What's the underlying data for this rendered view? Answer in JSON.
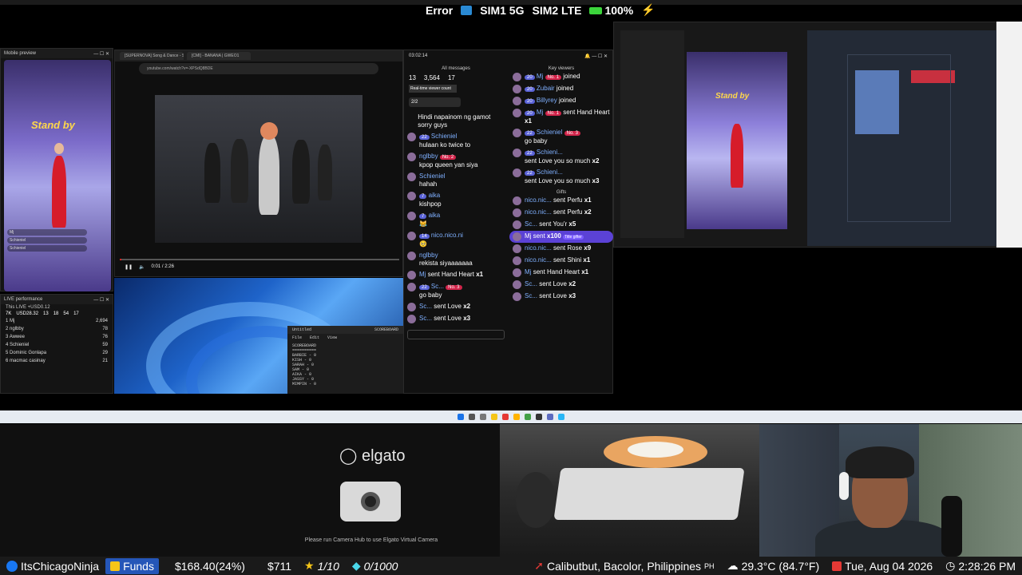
{
  "status_bar": {
    "error": "Error",
    "sim1": "SIM1 5G",
    "sim2": "SIM2 LTE",
    "battery": "100%"
  },
  "mobile_preview": {
    "title": "Mobile preview",
    "standby": "Stand by"
  },
  "live_performance": {
    "title": "LIVE performance",
    "subtitle": "This LIVE +USD0.12",
    "stats": [
      "7K",
      "USD28.32",
      "13",
      "18",
      "54",
      "17"
    ],
    "rows": [
      {
        "rank": "1",
        "name": "Mj",
        "score": "2,694"
      },
      {
        "rank": "2",
        "name": "nglbby",
        "score": "78"
      },
      {
        "rank": "3",
        "name": "Awwee",
        "score": "76"
      },
      {
        "rank": "4",
        "name": "Schieniel",
        "score": "59"
      },
      {
        "rank": "5",
        "name": "Dominic Gonlapa",
        "score": "29"
      },
      {
        "rank": "6",
        "name": "macmac casinay",
        "score": "21"
      }
    ]
  },
  "browser": {
    "tabs": [
      "[SUPERNOVA] Song & Dance - Sou",
      "[CMI] - BANANA | GWEO1"
    ],
    "url": "youtube.com/watch?v=-XPSdQ8BDE",
    "time": "0:01 / 2:26",
    "progress": 0.005
  },
  "notepad": {
    "title": "Untitled",
    "header": "SCOREBOARD",
    "menu": [
      "File",
      "Edit",
      "View"
    ],
    "lines": [
      "SCOREBOARD",
      "==========",
      "BARBIE - 0",
      "KISH - 0",
      "SARAH - 0",
      "SAM - 0",
      "AIKA - 0",
      "JASSY - 0",
      "MIMPIN - 0"
    ]
  },
  "chat": {
    "timer": "03:02:14",
    "all_messages": "All messages",
    "key_viewers": "Key viewers",
    "gifts_label": "Gifts",
    "viewers": "13",
    "views": "3,564",
    "likes": "17",
    "tooltip": "Real-time viewer count",
    "counter": "2/2",
    "messages": [
      {
        "user": "",
        "text": "Hindi napainom ng gamot sorry guys"
      },
      {
        "user": "Schieniel",
        "level": "22",
        "text": "hulaan ko twice to"
      },
      {
        "user": "nglbby",
        "badge": "No. 2",
        "text": "kpop queen yan siya"
      },
      {
        "user": "Schieniel",
        "text": "hahah"
      },
      {
        "user": "aika",
        "level": "7",
        "text": "kishpop"
      },
      {
        "user": "aika",
        "level": "7",
        "text": "😹"
      },
      {
        "user": "nico.nico.ni",
        "level": "14",
        "text": "🥺"
      },
      {
        "user": "nglbby",
        "text": "rekista siyaaaaaaa"
      },
      {
        "user": "Mj",
        "text": "sent Hand Heart",
        "mult": "x1"
      },
      {
        "user": "Sc...",
        "level": "22",
        "badge": "No. 3",
        "text": "go baby"
      },
      {
        "user": "Sc...",
        "text": "sent Love",
        "mult": "x2"
      },
      {
        "user": "Sc...",
        "text": "sent Love",
        "mult": "x3"
      }
    ],
    "key_viewer_events": [
      {
        "level": "20",
        "user": "Mj",
        "badge": "No. 1",
        "text": "joined"
      },
      {
        "level": "20",
        "user": "Zubair",
        "text": "joined"
      },
      {
        "level": "20",
        "user": "Billyrey",
        "text": "joined"
      },
      {
        "level": "20",
        "user": "Mj",
        "badge": "No. 1",
        "text": "sent Hand Heart",
        "mult": "x1"
      },
      {
        "level": "22",
        "user": "Schieniel",
        "badge": "No. 3",
        "text": "go baby"
      },
      {
        "level": "22",
        "user": "Schieni...",
        "text": "sent Love you so much",
        "mult": "x2"
      },
      {
        "level": "22",
        "user": "Schieni...",
        "text": "sent Love you so much",
        "mult": "x3"
      }
    ],
    "gifts": [
      {
        "user": "nico.nic...",
        "text": "sent Perfu",
        "mult": "x1"
      },
      {
        "user": "nico.nic...",
        "text": "sent Perfu",
        "mult": "x2"
      },
      {
        "user": "Sc...",
        "text": "sent You'r",
        "mult": "x5"
      },
      {
        "user": "Mj sent",
        "text": "",
        "mult": "x100",
        "tag": "Title gifter",
        "highlight": true
      },
      {
        "user": "nico.nic...",
        "text": "sent Rose",
        "mult": "x9"
      },
      {
        "user": "nico.nic...",
        "text": "sent Shini",
        "mult": "x1"
      },
      {
        "user": "Mj",
        "text": "sent Hand Heart",
        "mult": "x1"
      },
      {
        "user": "Sc...",
        "text": "sent Love",
        "mult": "x2"
      },
      {
        "user": "Sc...",
        "text": "sent Love",
        "mult": "x3"
      }
    ]
  },
  "elgato": {
    "logo": "elgato",
    "message": "Please run Camera Hub to use Elgato Virtual Camera"
  },
  "ticker": {
    "handle": "ItsChicagoNinja",
    "funds_label": "Funds",
    "funds_value": "$168.40(24%)",
    "amount": "$711",
    "ratio1": "1/10",
    "ratio2": "0/1000",
    "location": "Calibutbut, Bacolor, Philippines",
    "country": "PH",
    "weather": "29.3°C (84.7°F)",
    "date": "Tue, Aug 04 2026",
    "time": "2:28:26 PM"
  }
}
